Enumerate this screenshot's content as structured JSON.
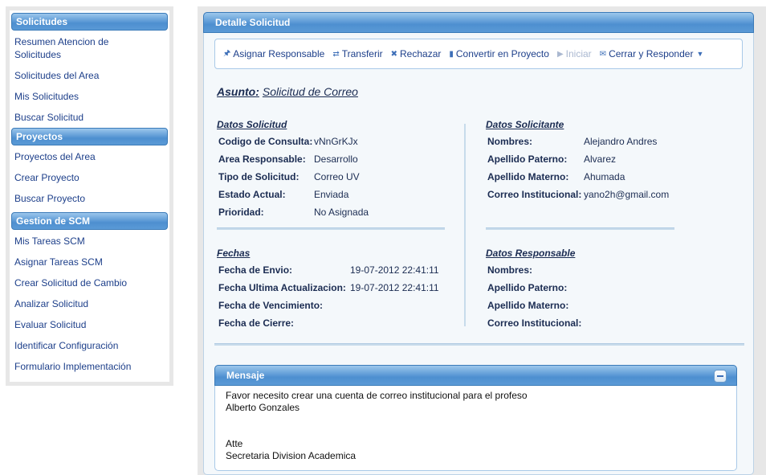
{
  "sidebar": {
    "sections": [
      {
        "title": "Solicitudes",
        "items": [
          "Resumen Atencion de Solicitudes",
          "Solicitudes del Area",
          "Mis Solicitudes",
          "Buscar Solicitud"
        ]
      },
      {
        "title": "Proyectos",
        "items": [
          "Proyectos del Area",
          "Crear Proyecto",
          "Buscar Proyecto"
        ]
      },
      {
        "title": "Gestion de SCM",
        "items": [
          "Mis Tareas SCM",
          "Asignar Tareas SCM",
          "Crear Solicitud de Cambio",
          "Analizar Solicitud",
          "Evaluar Solicitud",
          "Identificar Configuración",
          "Formulario Implementación"
        ]
      }
    ]
  },
  "panel": {
    "title": "Detalle Solicitud"
  },
  "toolbar": {
    "asignar": "Asignar Responsable",
    "transferir": "Transferir",
    "rechazar": "Rechazar",
    "convertir": "Convertir en Proyecto",
    "iniciar": "Iniciar",
    "cerrar": "Cerrar y Responder"
  },
  "asunto": {
    "label": "Asunto:",
    "value": "Solicitud de Correo"
  },
  "datos_solicitud": {
    "title": "Datos Solicitud",
    "fields": [
      {
        "label": "Codigo de Consulta:",
        "value": "vNnGrKJx"
      },
      {
        "label": "Area Responsable:",
        "value": "Desarrollo"
      },
      {
        "label": "Tipo de Solicitud:",
        "value": "Correo UV"
      },
      {
        "label": "Estado Actual:",
        "value": "Enviada"
      },
      {
        "label": "Prioridad:",
        "value": "No Asignada"
      }
    ]
  },
  "datos_solicitante": {
    "title": "Datos Solicitante",
    "fields": [
      {
        "label": "Nombres:",
        "value": "Alejandro Andres"
      },
      {
        "label": "Apellido Paterno:",
        "value": "Alvarez"
      },
      {
        "label": "Apellido Materno:",
        "value": "Ahumada"
      },
      {
        "label": "Correo Institucional:",
        "value": "yano2h@gmail.com"
      }
    ]
  },
  "fechas": {
    "title": "Fechas",
    "fields": [
      {
        "label": "Fecha de Envio:",
        "value": "19-07-2012 22:41:11"
      },
      {
        "label": "Fecha Ultima Actualizacion:",
        "value": "19-07-2012 22:41:11"
      },
      {
        "label": "Fecha de Vencimiento:",
        "value": ""
      },
      {
        "label": "Fecha de Cierre:",
        "value": ""
      }
    ]
  },
  "datos_responsable": {
    "title": "Datos Responsable",
    "fields": [
      {
        "label": "Nombres:",
        "value": ""
      },
      {
        "label": "Apellido Paterno:",
        "value": ""
      },
      {
        "label": "Apellido Materno:",
        "value": ""
      },
      {
        "label": "Correo Institucional:",
        "value": ""
      }
    ]
  },
  "mensaje": {
    "title": "Mensaje",
    "body": "Favor necesito crear una cuenta de correo institucional para el profeso\nAlberto Gonzales\n\n\n           Atte\nSecretaria Division Academica"
  }
}
